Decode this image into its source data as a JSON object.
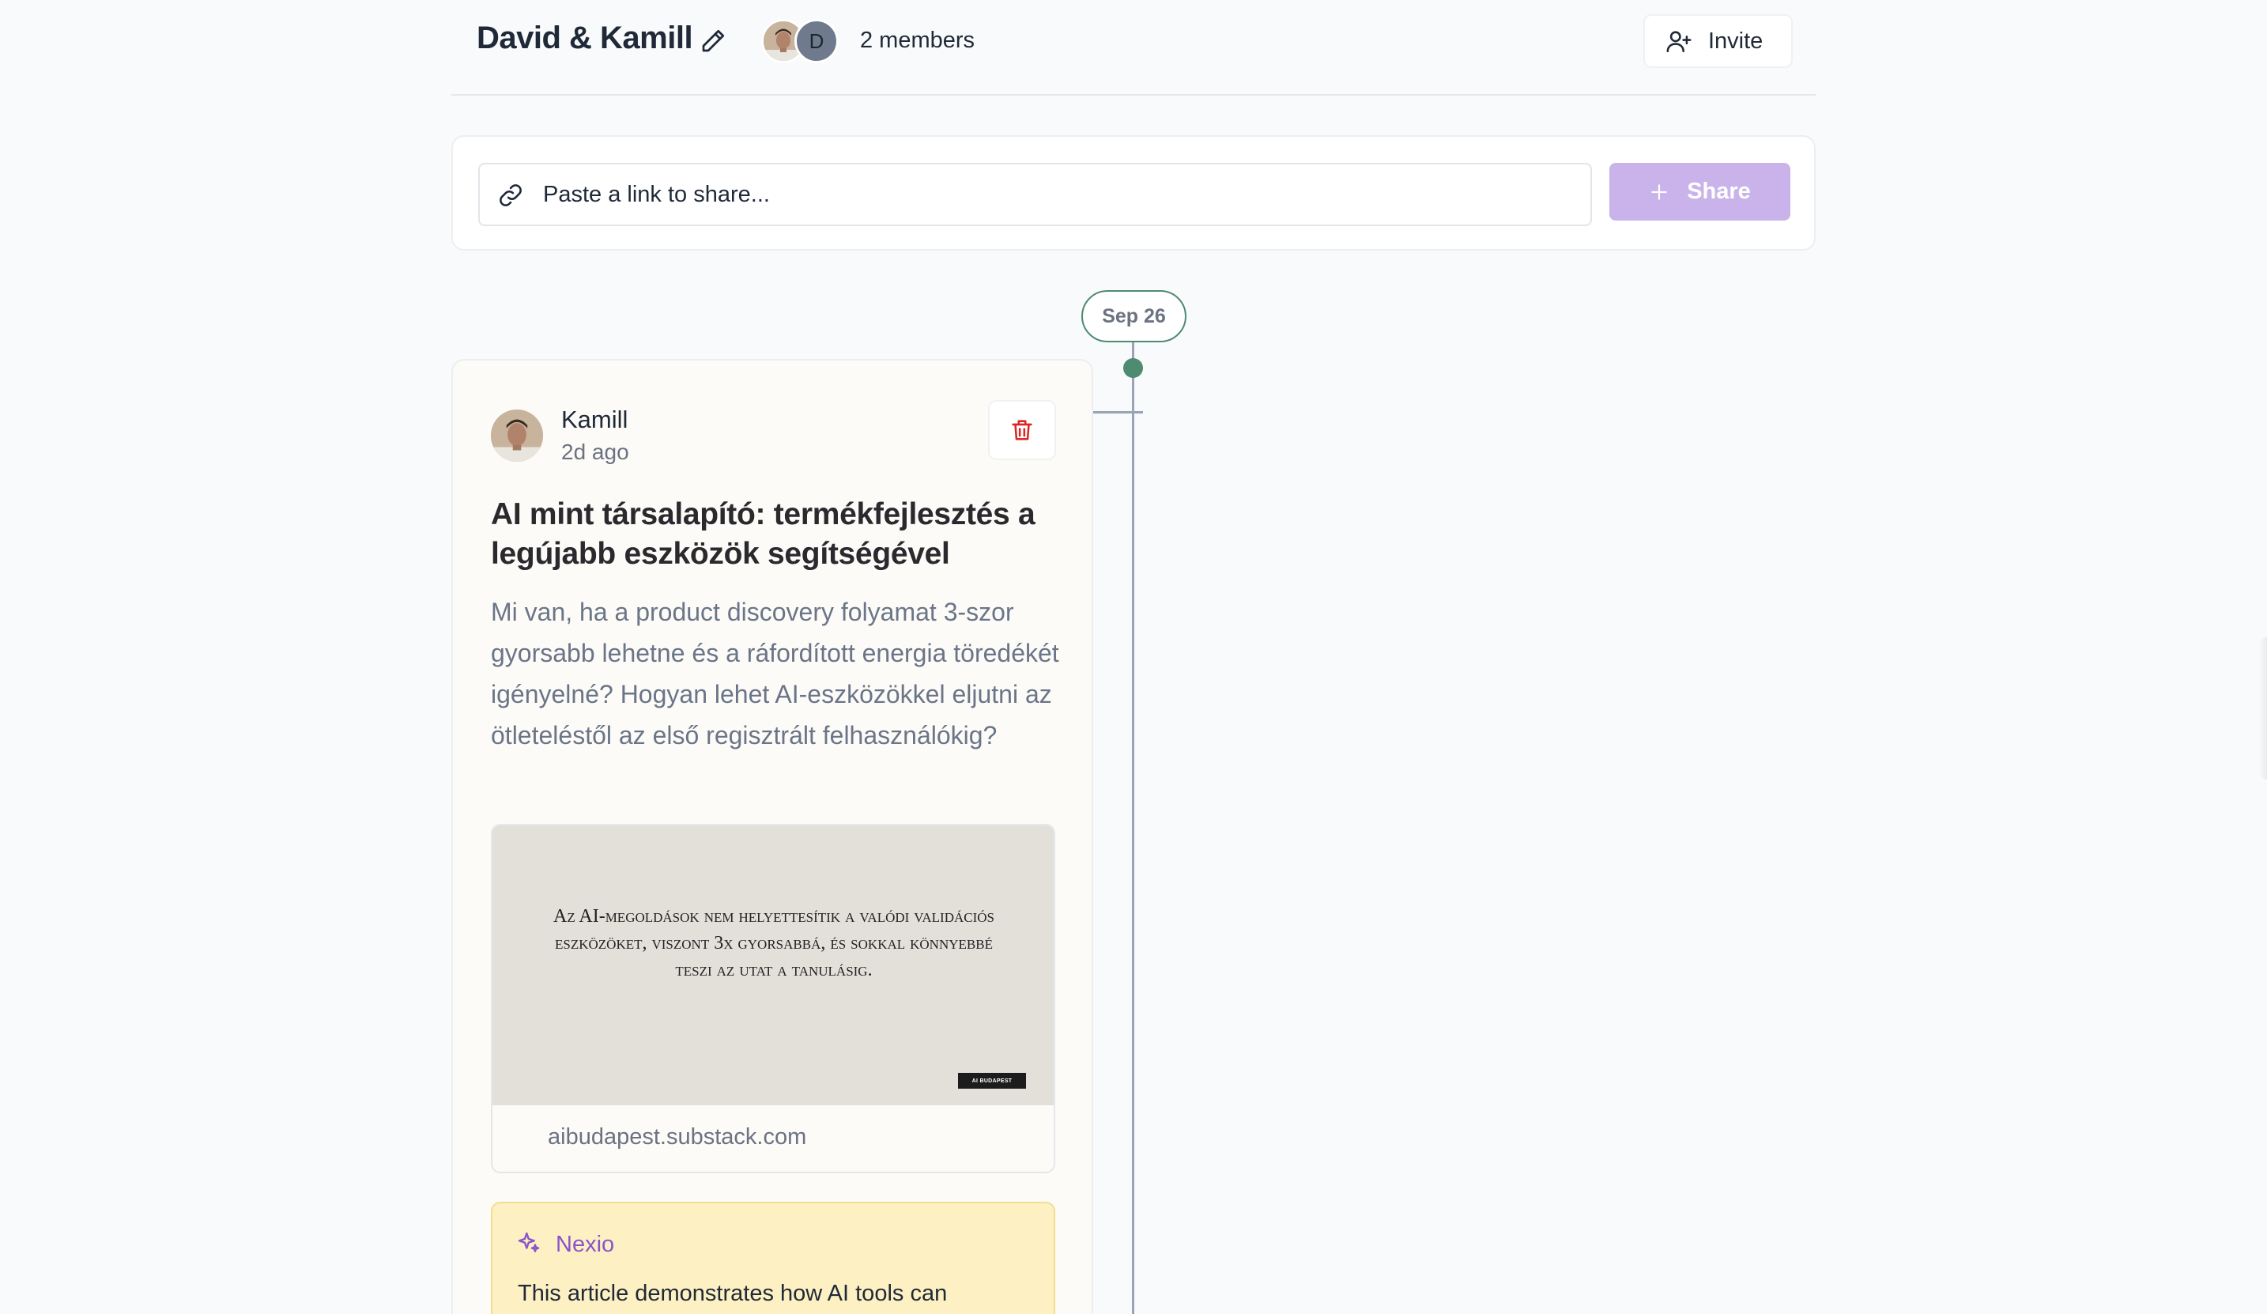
{
  "header": {
    "group_title": "David & Kamill",
    "members_count": "2 members",
    "avatar_letter": "D",
    "invite_label": "Invite"
  },
  "share_bar": {
    "placeholder": "Paste a link to share...",
    "share_label": "Share"
  },
  "timeline": {
    "date_label": "Sep 26"
  },
  "post": {
    "author": "Kamill",
    "time_ago": "2d ago",
    "title": "AI mint társalapító: termékfejlesztés a legújabb eszközök segítségével",
    "excerpt": "Mi van, ha a product discovery folyamat 3-szor gyorsabb lehetne és a ráfordított energia töredékét igényelné? Hogyan lehet AI-eszközökkel eljutni az ötleteléstől az első regisztrált felhasználókig?",
    "preview": {
      "quote": "Az AI-megoldások nem helyettesítik a valódi validációs eszközöket, viszont 3x gyorsabbá, és sokkal könnyebbé teszi az utat a tanulásig.",
      "badge": "AI BUDAPEST",
      "domain": "aibudapest.substack.com"
    },
    "nexio": {
      "name": "Nexio",
      "text": "This article demonstrates how AI tools can"
    }
  },
  "colors": {
    "accent_purple": "#c9b3ea",
    "timeline_green": "#4f8a72",
    "nexio_bg": "#fdf0c3",
    "delete_red": "#dc2626"
  },
  "icons": {
    "edit": "pencil-icon",
    "invite": "user-plus-icon",
    "link": "link-icon",
    "share": "plus-icon",
    "delete": "trash-icon",
    "nexio": "sparkles-icon"
  }
}
